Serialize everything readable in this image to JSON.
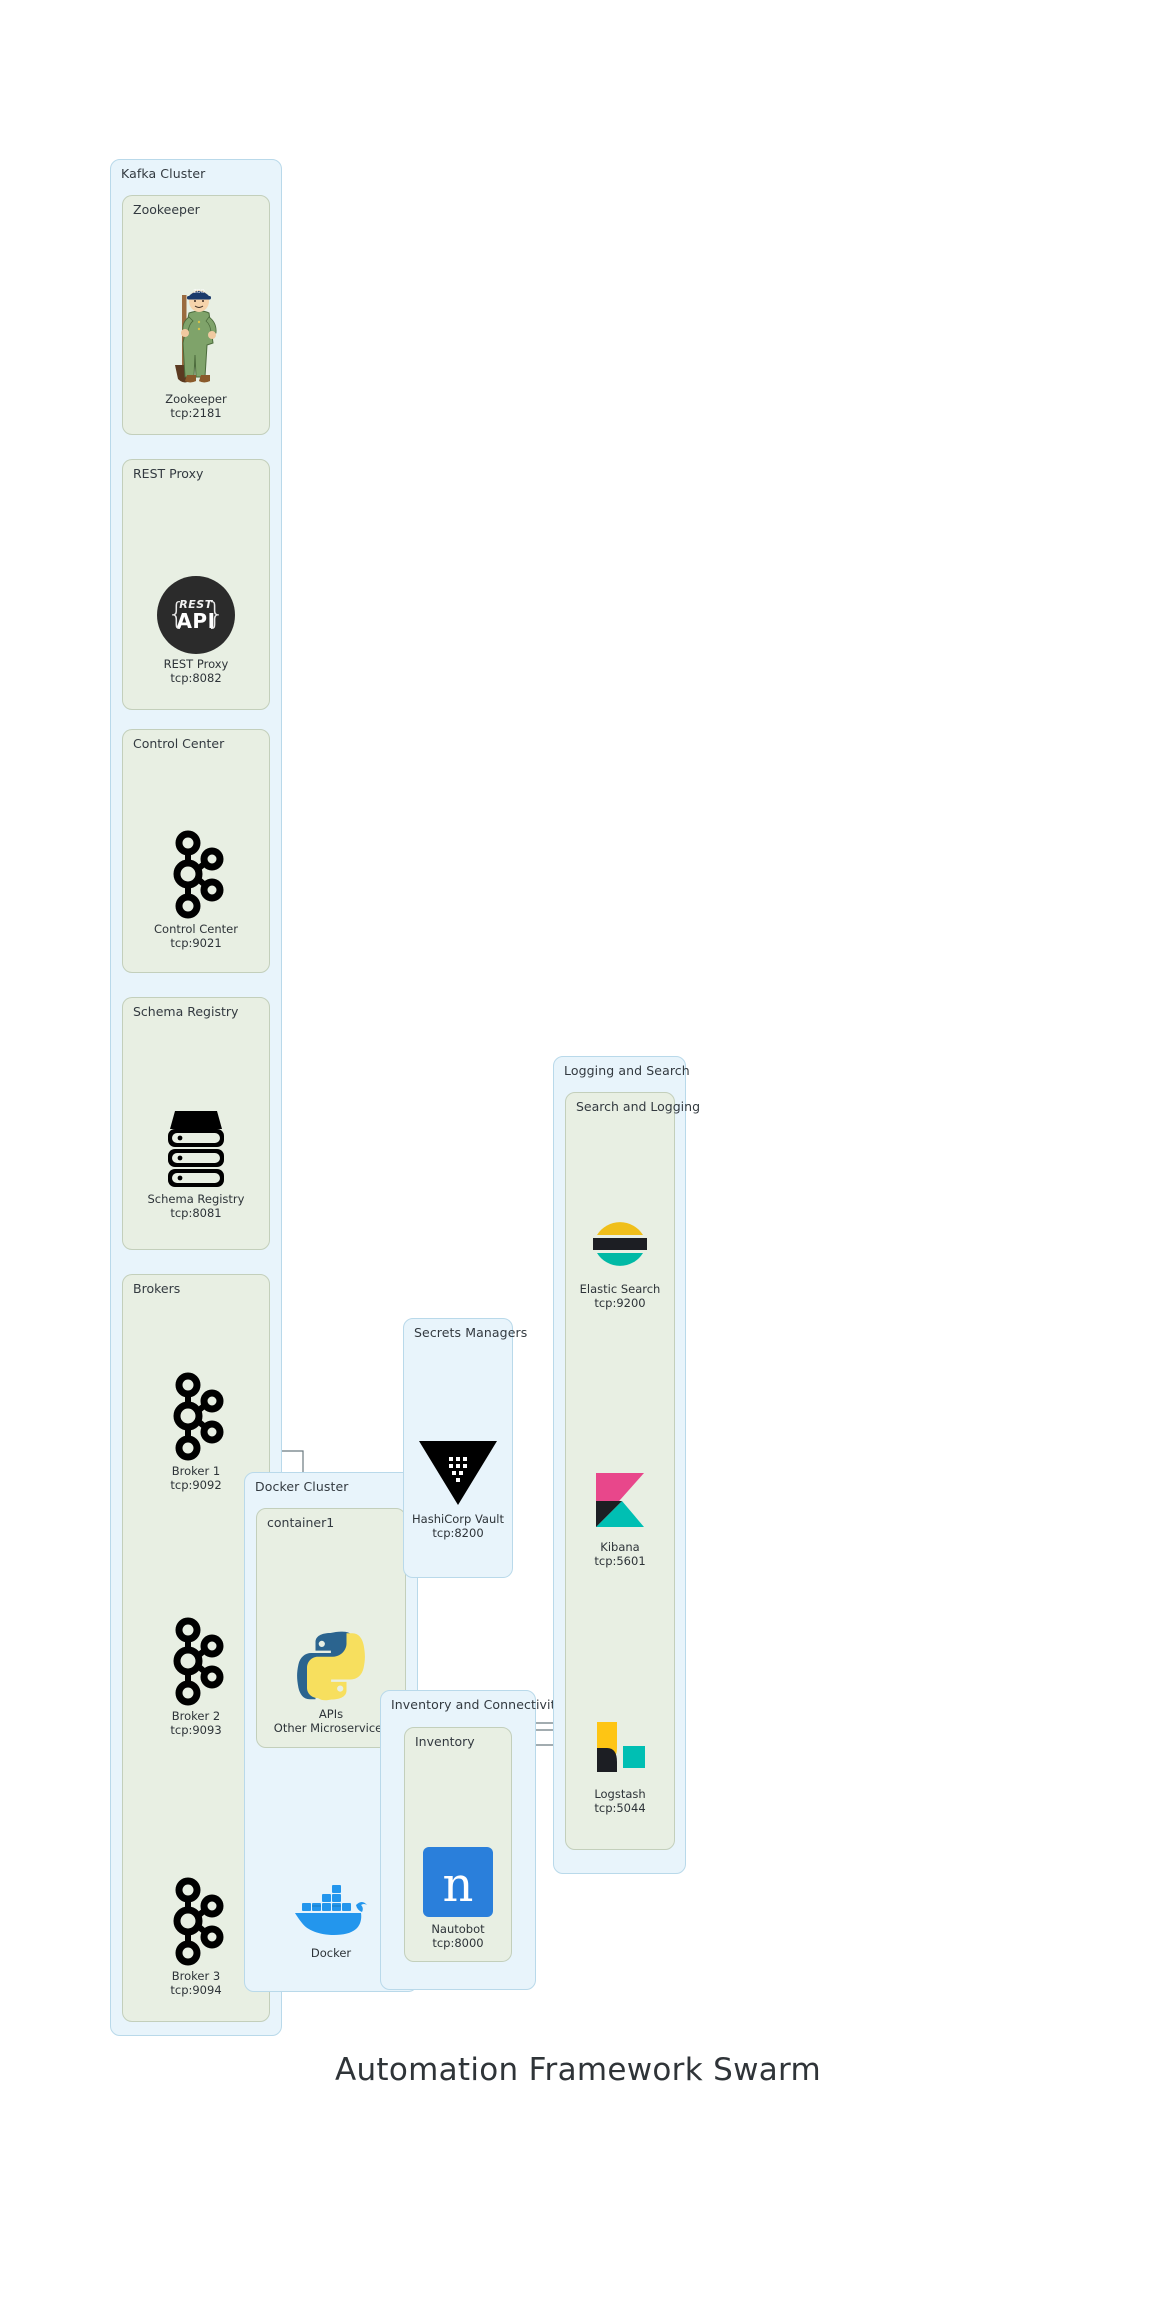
{
  "title": "Automation Framework Swarm",
  "clusters": {
    "kafka": {
      "label": "Kafka Cluster"
    },
    "docker": {
      "label": "Docker Cluster"
    },
    "secrets": {
      "label": "Secrets Managers"
    },
    "inventory_conn": {
      "label": "Inventory and Connectivity"
    },
    "logging": {
      "label": "Logging and Search"
    }
  },
  "groups": {
    "zookeeper": {
      "label": "Zookeeper"
    },
    "rest_proxy": {
      "label": "REST Proxy"
    },
    "control_center": {
      "label": "Control Center"
    },
    "schema_registry": {
      "label": "Schema Registry"
    },
    "brokers": {
      "label": "Brokers"
    },
    "container1": {
      "label": "container1"
    },
    "inventory": {
      "label": "Inventory"
    },
    "search_logging": {
      "label": "Search and Logging"
    }
  },
  "nodes": {
    "zookeeper": {
      "name": "Zookeeper",
      "port": "tcp:2181",
      "icon": "zookeeper-mascot-icon"
    },
    "rest_proxy": {
      "name": "REST Proxy",
      "port": "tcp:8082",
      "icon": "rest-api-icon"
    },
    "control_center": {
      "name": "Control Center",
      "port": "tcp:9021",
      "icon": "kafka-icon"
    },
    "schema_registry": {
      "name": "Schema Registry",
      "port": "tcp:8081",
      "icon": "server-rack-icon"
    },
    "broker1": {
      "name": "Broker 1",
      "port": "tcp:9092",
      "icon": "kafka-icon"
    },
    "broker2": {
      "name": "Broker 2",
      "port": "tcp:9093",
      "icon": "kafka-icon"
    },
    "broker3": {
      "name": "Broker 3",
      "port": "tcp:9094",
      "icon": "kafka-icon"
    },
    "apis": {
      "name": "APIs",
      "port": "Other Microservices",
      "icon": "python-icon"
    },
    "docker": {
      "name": "Docker",
      "port": "",
      "icon": "docker-whale-icon"
    },
    "vault": {
      "name": "HashiCorp Vault",
      "port": "tcp:8200",
      "icon": "vault-icon"
    },
    "nautobot": {
      "name": "Nautobot",
      "port": "tcp:8000",
      "icon": "nautobot-icon"
    },
    "elastic": {
      "name": "Elastic Search",
      "port": "tcp:9200",
      "icon": "elasticsearch-icon"
    },
    "kibana": {
      "name": "Kibana",
      "port": "tcp:5601",
      "icon": "kibana-icon"
    },
    "logstash": {
      "name": "Logstash",
      "port": "tcp:5044",
      "icon": "logstash-icon"
    }
  },
  "colors": {
    "cluster_fill": "#e8f4fb",
    "cluster_stroke": "#b9d9ea",
    "group_fill": "#e8efe3",
    "group_stroke": "#c3cfbb",
    "edge": "#6b7a80",
    "python_blue": "#2b648f",
    "python_yellow": "#f7df5e",
    "docker_blue": "#2396ed",
    "vault_black": "#000000",
    "nautobot_blue": "#2a7fdb",
    "elastic_yellow": "#f0bf1a",
    "elastic_teal": "#00b9a5",
    "kibana_pink": "#e8478b",
    "kibana_teal": "#00bfb3",
    "logstash_yellow": "#fec514"
  }
}
